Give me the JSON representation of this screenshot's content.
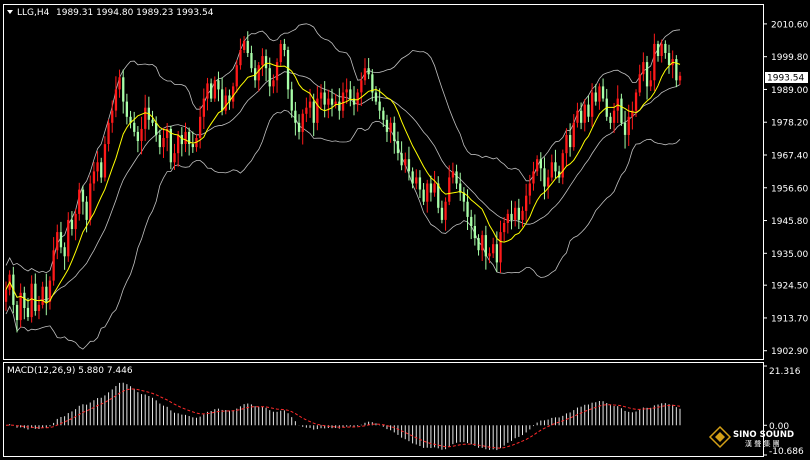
{
  "header": {
    "symbol": "LLG,H4",
    "ohlc": "1989.31 1994.80 1989.23 1993.54"
  },
  "price_tag": "1993.54",
  "logo": {
    "name": "SINO SOUND",
    "sub": "漢 聲 集 團"
  },
  "colors": {
    "bull": "#ff1a1a",
    "bear": "#a8ffa8",
    "ma": "#ffff00",
    "band": "#c0c0c0",
    "signal": "#ff2a2a",
    "hist": "#e8e8e8",
    "grid_border": "#ffffff"
  },
  "chart_data": [
    {
      "type": "candlestick",
      "title": "LLG,H4",
      "ylim": [
        1900.5,
        2016.5
      ],
      "y_ticks": [
        "2010.60",
        "1999.80",
        "1989.00",
        "1978.20",
        "1967.40",
        "1956.60",
        "1945.80",
        "1935.00",
        "1924.50",
        "1913.70",
        "1902.90"
      ],
      "overlays": [
        "Bollinger Bands",
        "Moving Average"
      ],
      "close": [
        1923,
        1928,
        1918,
        1913,
        1922,
        1917,
        1914,
        1925,
        1916,
        1918,
        1924,
        1919,
        1926,
        1936,
        1942,
        1937,
        1934,
        1946,
        1943,
        1948,
        1956,
        1952,
        1946,
        1958,
        1962,
        1965,
        1960,
        1971,
        1978,
        1982,
        1989,
        1993,
        1985,
        1980,
        1978,
        1975,
        1972,
        1976,
        1983,
        1979,
        1978,
        1974,
        1970,
        1973,
        1976,
        1965,
        1968,
        1974,
        1971,
        1975,
        1971,
        1970,
        1973,
        1980,
        1986,
        1991,
        1986,
        1992,
        1989,
        1982,
        1987,
        1985,
        1990,
        1997,
        2002,
        2005,
        2001,
        1996,
        1992,
        1997,
        2000,
        1996,
        1990,
        1992,
        1998,
        2004,
        2002,
        1989,
        1982,
        1978,
        1975,
        1981,
        1983,
        1985,
        1978,
        1986,
        1988,
        1984,
        1986,
        1984,
        1985,
        1982,
        1988,
        1989,
        1986,
        1984,
        1988,
        1992,
        1996,
        1994,
        1988,
        1985,
        1982,
        1979,
        1975,
        1978,
        1972,
        1968,
        1964,
        1966,
        1962,
        1958,
        1960,
        1956,
        1952,
        1958,
        1955,
        1958,
        1950,
        1946,
        1952,
        1960,
        1962,
        1958,
        1955,
        1952,
        1947,
        1944,
        1940,
        1936,
        1941,
        1934,
        1935,
        1938,
        1932,
        1942,
        1945,
        1948,
        1946,
        1950,
        1946,
        1949,
        1954,
        1958,
        1962,
        1966,
        1963,
        1957,
        1960,
        1965,
        1962,
        1960,
        1968,
        1974,
        1970,
        1978,
        1982,
        1978,
        1984,
        1980,
        1988,
        1985,
        1990,
        1986,
        1980,
        1978,
        1982,
        1986,
        1978,
        1974,
        1980,
        1982,
        1988,
        1994,
        1998,
        1990,
        1992,
        2004,
        2000,
        2004,
        2001,
        1997,
        1999,
        1992,
        1993.5
      ]
    },
    {
      "type": "histogram",
      "title": "MACD(12,26,9) 5.880 7.446",
      "indicator": "MACD(12,26,9)",
      "macd": 5.88,
      "signal": 7.446,
      "ylim": [
        -10.686,
        21.316
      ],
      "y_ticks": [
        "21.316",
        "0.00",
        "-10.686"
      ]
    }
  ]
}
